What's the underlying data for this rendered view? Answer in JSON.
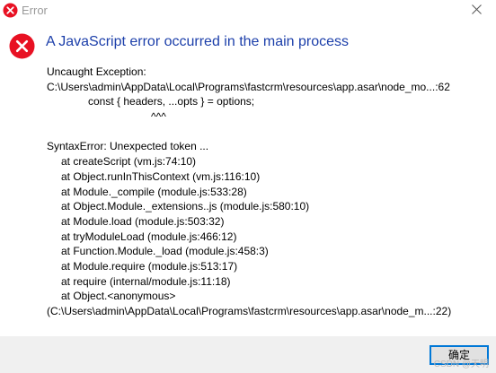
{
  "window": {
    "title": "Error",
    "heading": "A JavaScript error occurred in the main process"
  },
  "message": {
    "lines": [
      {
        "text": "Uncaught Exception:",
        "indent": 0
      },
      {
        "text": "C:\\Users\\admin\\AppData\\Local\\Programs\\fastcrm\\resources\\app.asar\\node_mo...:62",
        "indent": 0
      },
      {
        "text": "const { headers, ...opts } = options;",
        "indent": 2
      },
      {
        "text": "^^^",
        "indent": 3
      },
      {
        "text": "",
        "indent": 0
      },
      {
        "text": "SyntaxError: Unexpected token ...",
        "indent": 0
      },
      {
        "text": "at createScript (vm.js:74:10)",
        "indent": 1
      },
      {
        "text": "at Object.runInThisContext (vm.js:116:10)",
        "indent": 1
      },
      {
        "text": "at Module._compile (module.js:533:28)",
        "indent": 1
      },
      {
        "text": "at Object.Module._extensions..js (module.js:580:10)",
        "indent": 1
      },
      {
        "text": "at Module.load (module.js:503:32)",
        "indent": 1
      },
      {
        "text": "at tryModuleLoad (module.js:466:12)",
        "indent": 1
      },
      {
        "text": "at Function.Module._load (module.js:458:3)",
        "indent": 1
      },
      {
        "text": "at Module.require (module.js:513:17)",
        "indent": 1
      },
      {
        "text": "at require (internal/module.js:11:18)",
        "indent": 1
      },
      {
        "text": "at Object.<anonymous>",
        "indent": 1
      },
      {
        "text": "(C:\\Users\\admin\\AppData\\Local\\Programs\\fastcrm\\resources\\app.asar\\node_m...:22)",
        "indent": 0
      }
    ]
  },
  "buttons": {
    "ok_label": "确定"
  },
  "watermark": "CSDN @天明",
  "icons": {
    "title": "error-icon",
    "dialog": "error-icon",
    "close": "close-icon"
  },
  "colors": {
    "error_red": "#e81123",
    "heading_blue": "#1c3faa",
    "footer_bg": "#f0f0f0",
    "focus_border": "#0078d7"
  }
}
